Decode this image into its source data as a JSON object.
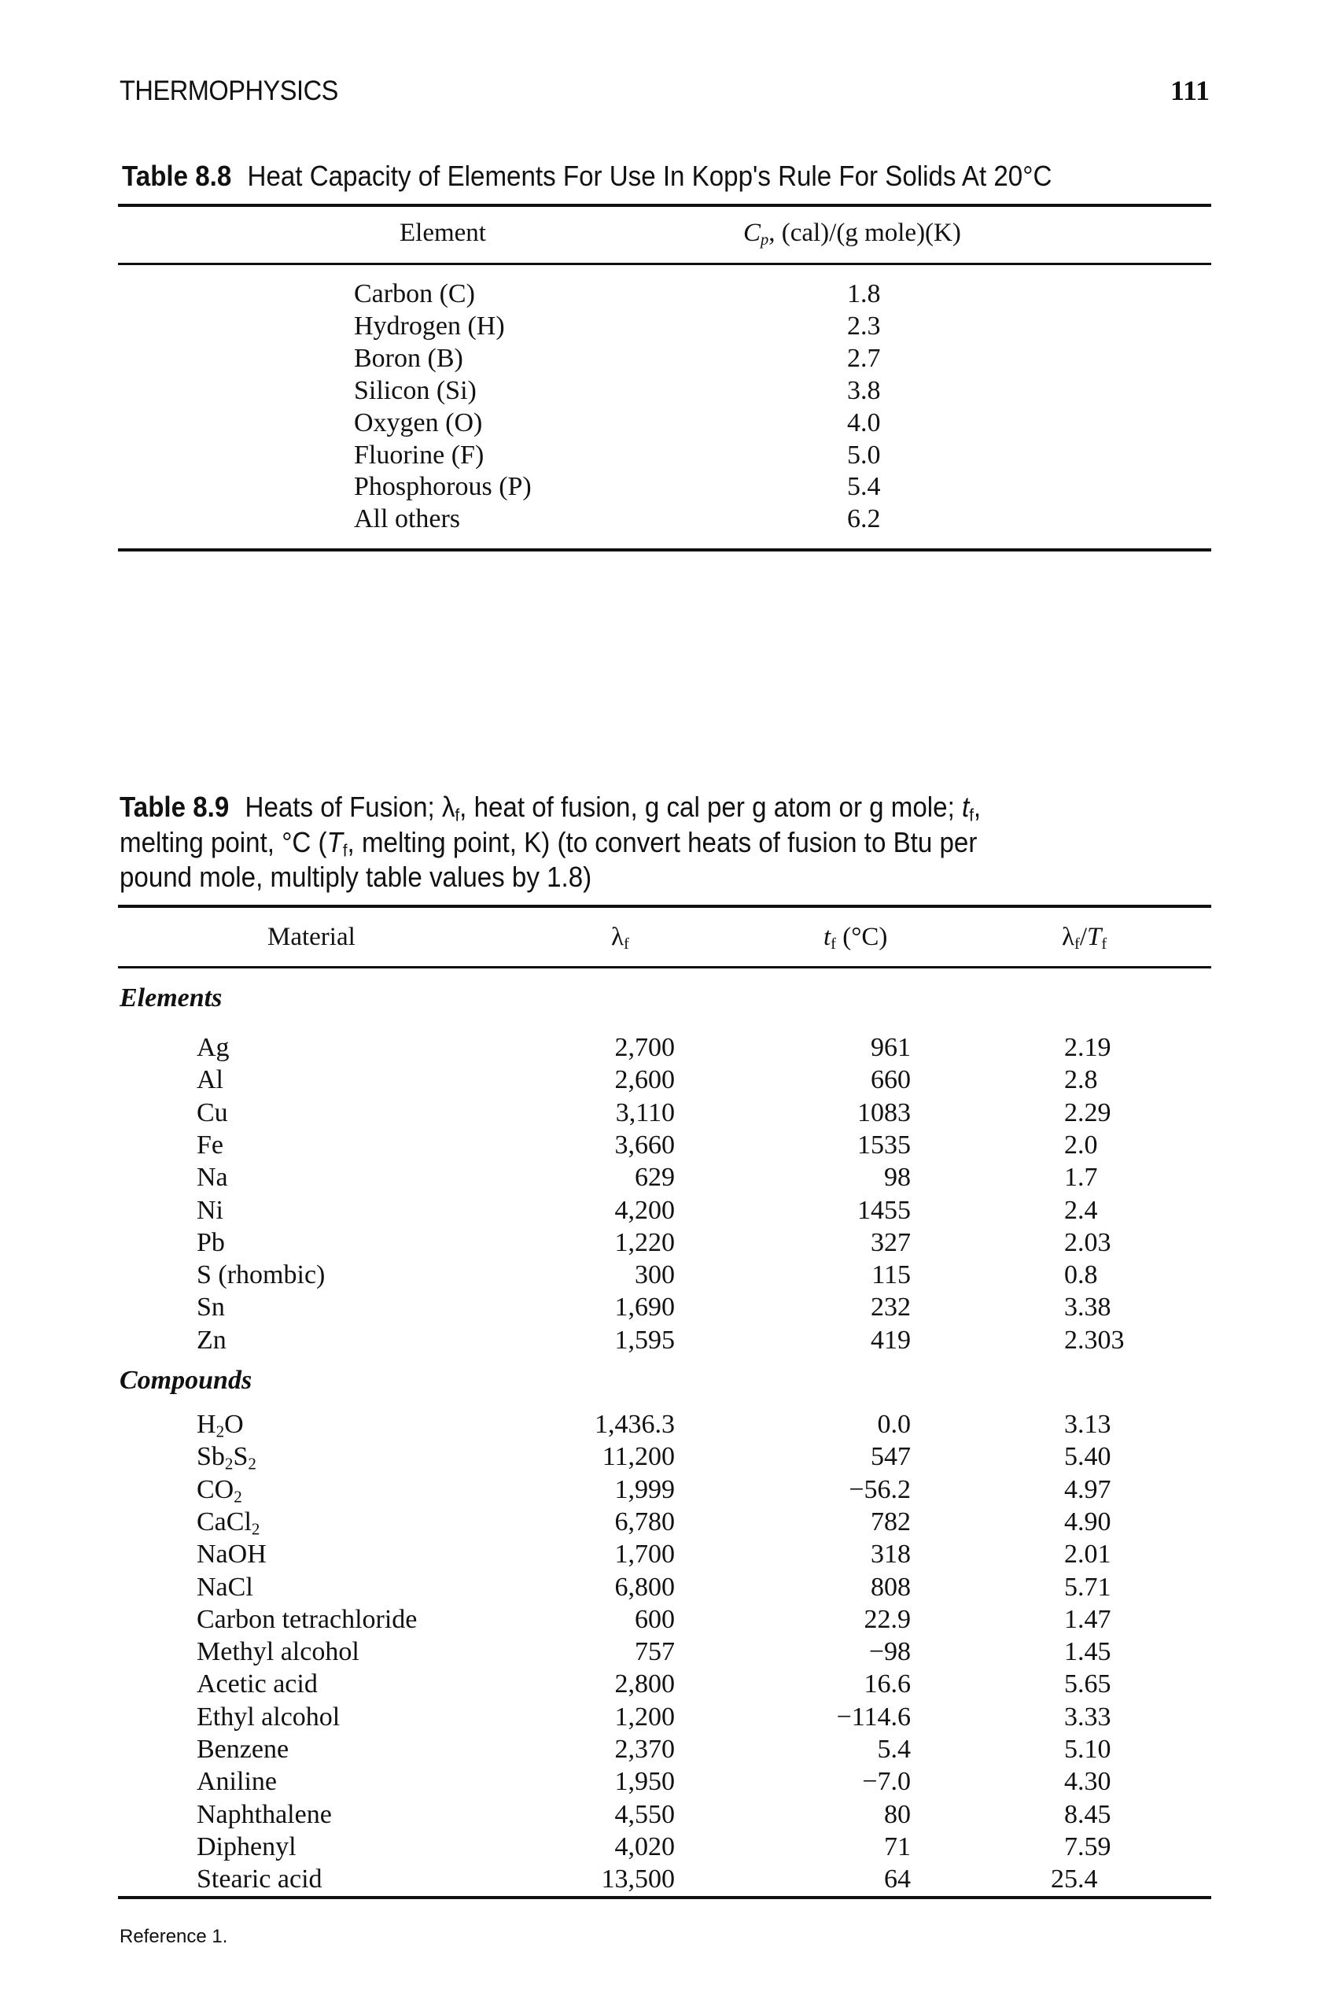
{
  "page": {
    "running_head": "THERMOPHYSICS",
    "page_number": "111",
    "reference": "Reference 1."
  },
  "table_8_8": {
    "label": "Table 8.8",
    "caption": "Heat Capacity of Elements For Use In Kopp's Rule For Solids At 20°C",
    "headers": {
      "element": "Element",
      "cp_symbol": "C",
      "cp_sub": "p",
      "cp_units": ", (cal)/(g mole)(K)"
    },
    "rows": [
      {
        "element": "Carbon (C)",
        "cp": "1.8"
      },
      {
        "element": "Hydrogen (H)",
        "cp": "2.3"
      },
      {
        "element": "Boron (B)",
        "cp": "2.7"
      },
      {
        "element": "Silicon (Si)",
        "cp": "3.8"
      },
      {
        "element": "Oxygen (O)",
        "cp": "4.0"
      },
      {
        "element": "Fluorine (F)",
        "cp": "5.0"
      },
      {
        "element": "Phosphorous (P)",
        "cp": "5.4"
      },
      {
        "element": "All others",
        "cp": "6.2"
      }
    ]
  },
  "table_8_9": {
    "label": "Table 8.9",
    "caption_lines": [
      [
        {
          "t": "Heats of Fusion; "
        },
        {
          "t": "λ"
        },
        {
          "t": "f",
          "sub": true
        },
        {
          "t": ", heat of fusion, g cal per g atom or g mole; "
        },
        {
          "t": "t",
          "i": true
        },
        {
          "t": "f",
          "sub": true
        },
        {
          "t": ","
        }
      ],
      [
        {
          "t": "melting point, °C ("
        },
        {
          "t": "T",
          "i": true
        },
        {
          "t": "f",
          "sub": true
        },
        {
          "t": ", melting point, K) (to convert heats of fusion to Btu per"
        }
      ],
      [
        {
          "t": "pound mole, multiply table values by 1.8)"
        }
      ]
    ],
    "headers": {
      "material": "Material",
      "lambda": [
        {
          "t": "λ"
        },
        {
          "t": "f",
          "sub": true
        }
      ],
      "tf": [
        {
          "t": "t",
          "i": true
        },
        {
          "t": "f",
          "sub": true
        },
        {
          "t": " (°C)"
        }
      ],
      "ratio": [
        {
          "t": "λ"
        },
        {
          "t": "f",
          "sub": true
        },
        {
          "t": "/"
        },
        {
          "t": "T",
          "i": true
        },
        {
          "t": "f",
          "sub": true
        }
      ]
    },
    "groups": [
      {
        "label": "Elements",
        "rows": [
          {
            "name": [
              {
                "t": "Ag"
              }
            ],
            "lambda_f": "2,700",
            "t_f": "961",
            "ratio": "2.19"
          },
          {
            "name": [
              {
                "t": "Al"
              }
            ],
            "lambda_f": "2,600",
            "t_f": "660",
            "ratio": "2.8"
          },
          {
            "name": [
              {
                "t": "Cu"
              }
            ],
            "lambda_f": "3,110",
            "t_f": "1083",
            "ratio": "2.29"
          },
          {
            "name": [
              {
                "t": "Fe"
              }
            ],
            "lambda_f": "3,660",
            "t_f": "1535",
            "ratio": "2.0"
          },
          {
            "name": [
              {
                "t": "Na"
              }
            ],
            "lambda_f": "629",
            "t_f": "98",
            "ratio": "1.7"
          },
          {
            "name": [
              {
                "t": "Ni"
              }
            ],
            "lambda_f": "4,200",
            "t_f": "1455",
            "ratio": "2.4"
          },
          {
            "name": [
              {
                "t": "Pb"
              }
            ],
            "lambda_f": "1,220",
            "t_f": "327",
            "ratio": "2.03"
          },
          {
            "name": [
              {
                "t": "S (rhombic)"
              }
            ],
            "lambda_f": "300",
            "t_f": "115",
            "ratio": "0.8"
          },
          {
            "name": [
              {
                "t": "Sn"
              }
            ],
            "lambda_f": "1,690",
            "t_f": "232",
            "ratio": "3.38"
          },
          {
            "name": [
              {
                "t": "Zn"
              }
            ],
            "lambda_f": "1,595",
            "t_f": "419",
            "ratio": "2.303"
          }
        ]
      },
      {
        "label": "Compounds",
        "rows": [
          {
            "name": [
              {
                "t": "H"
              },
              {
                "t": "2",
                "sub": true
              },
              {
                "t": "O"
              }
            ],
            "lambda_f": "1,436.3",
            "t_f": "0.0",
            "ratio": "3.13"
          },
          {
            "name": [
              {
                "t": "Sb"
              },
              {
                "t": "2",
                "sub": true
              },
              {
                "t": "S"
              },
              {
                "t": "2",
                "sub": true
              }
            ],
            "lambda_f": "11,200",
            "t_f": "547",
            "ratio": "5.40"
          },
          {
            "name": [
              {
                "t": "CO"
              },
              {
                "t": "2",
                "sub": true
              }
            ],
            "lambda_f": "1,999",
            "t_f": "−56.2",
            "ratio": "4.97"
          },
          {
            "name": [
              {
                "t": "CaCl"
              },
              {
                "t": "2",
                "sub": true
              }
            ],
            "lambda_f": "6,780",
            "t_f": "782",
            "ratio": "4.90"
          },
          {
            "name": [
              {
                "t": "NaOH"
              }
            ],
            "lambda_f": "1,700",
            "t_f": "318",
            "ratio": "2.01"
          },
          {
            "name": [
              {
                "t": "NaCl"
              }
            ],
            "lambda_f": "6,800",
            "t_f": "808",
            "ratio": "5.71"
          },
          {
            "name": [
              {
                "t": "Carbon tetrachloride"
              }
            ],
            "lambda_f": "600",
            "t_f": "22.9",
            "ratio": "1.47"
          },
          {
            "name": [
              {
                "t": "Methyl alcohol"
              }
            ],
            "lambda_f": "757",
            "t_f": "−98",
            "ratio": "1.45"
          },
          {
            "name": [
              {
                "t": "Acetic acid"
              }
            ],
            "lambda_f": "2,800",
            "t_f": "16.6",
            "ratio": "5.65"
          },
          {
            "name": [
              {
                "t": "Ethyl alcohol"
              }
            ],
            "lambda_f": "1,200",
            "t_f": "−114.6",
            "ratio": "3.33"
          },
          {
            "name": [
              {
                "t": "Benzene"
              }
            ],
            "lambda_f": "2,370",
            "t_f": "5.4",
            "ratio": "5.10"
          },
          {
            "name": [
              {
                "t": "Aniline"
              }
            ],
            "lambda_f": "1,950",
            "t_f": "−7.0",
            "ratio": "4.30"
          },
          {
            "name": [
              {
                "t": "Naphthalene"
              }
            ],
            "lambda_f": "4,550",
            "t_f": "80",
            "ratio": "8.45"
          },
          {
            "name": [
              {
                "t": "Diphenyl"
              }
            ],
            "lambda_f": "4,020",
            "t_f": "71",
            "ratio": "7.59"
          },
          {
            "name": [
              {
                "t": "Stearic acid"
              }
            ],
            "lambda_f": "13,500",
            "t_f": "64",
            "ratio": "25.4"
          }
        ]
      }
    ]
  }
}
